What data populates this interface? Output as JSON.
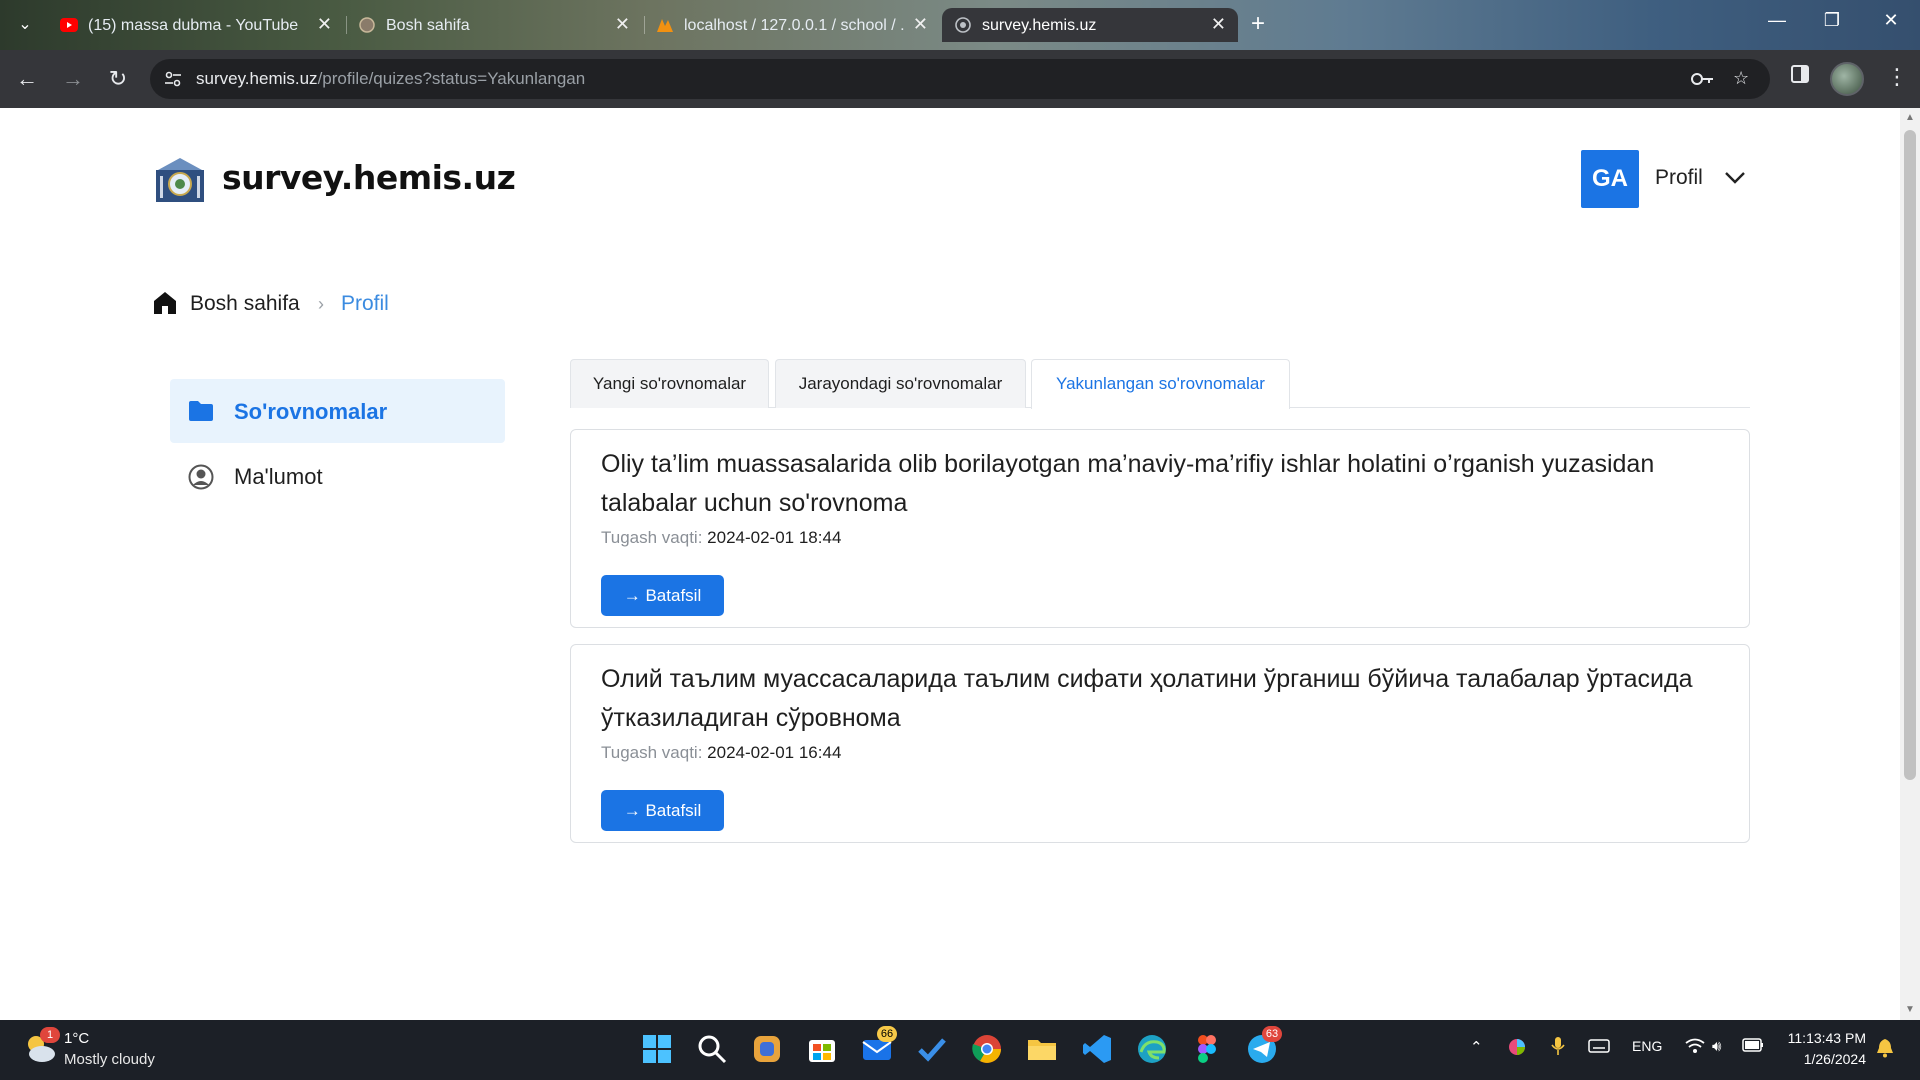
{
  "browser": {
    "tabs": [
      {
        "title": "(15) massa dubma - YouTube",
        "favicon": "youtube-icon"
      },
      {
        "title": "Bosh sahifa",
        "favicon": "seal-icon"
      },
      {
        "title": "localhost / 127.0.0.1 / school / ...",
        "favicon": "phpmyadmin-icon"
      },
      {
        "title": "survey.hemis.uz",
        "favicon": "globe-icon",
        "active": true
      }
    ],
    "url_host": "survey.hemis.uz",
    "url_path": "/profile/quizes?status=Yakunlangan"
  },
  "header": {
    "site_title": "survey.hemis.uz",
    "user_initials": "GA",
    "profile_label": "Profil"
  },
  "breadcrumb": {
    "home": "Bosh sahifa",
    "current": "Profil"
  },
  "sidebar": {
    "items": [
      {
        "label": "So'rovnomalar",
        "icon": "folder-icon",
        "active": true
      },
      {
        "label": "Ma'lumot",
        "icon": "user-circle-icon",
        "active": false
      }
    ]
  },
  "main": {
    "tabs": [
      {
        "label": "Yangi so'rovnomalar"
      },
      {
        "label": "Jarayondagi so'rovnomalar"
      },
      {
        "label": "Yakunlangan so'rovnomalar",
        "active": true
      }
    ],
    "surveys": [
      {
        "title": "Oliy ta’lim muassasalarida olib borilayotgan ma’naviy-ma’rifiy ishlar holatini o’rganish yuzasidan talabalar uchun so'rovnoma",
        "deadline_label": "Tugash vaqti:",
        "deadline": "2024-02-01 18:44",
        "button": "→  Batafsil"
      },
      {
        "title": "Олий таълим муассасаларида таълим сифати ҳолатини ўрганиш бўйича талабалар ўртасида ўтказиладиган сўровнома",
        "deadline_label": "Tugash vaqti:",
        "deadline": "2024-02-01 16:44",
        "button": "→  Batafsil"
      }
    ]
  },
  "taskbar": {
    "weather_temp": "1°C",
    "weather_desc": "Mostly cloudy",
    "weather_alert": "1",
    "badges": {
      "mail": "66",
      "telegram": "63"
    },
    "lang": "ENG",
    "time": "11:13:43 PM",
    "date": "1/26/2024"
  },
  "colors": {
    "accent": "#1b74e4",
    "active_bg": "#e8f3fd",
    "footer": "#0f1a2e"
  }
}
